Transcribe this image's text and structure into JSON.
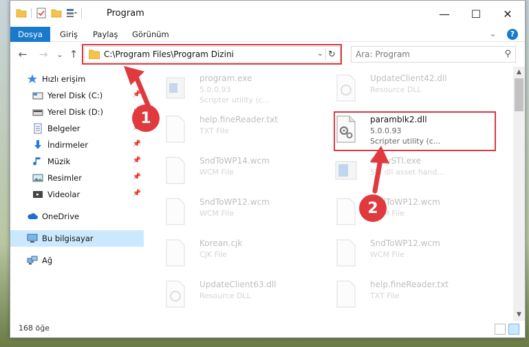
{
  "window": {
    "title": "Program",
    "minimize_glyph": "—",
    "maximize_glyph": "☐",
    "close_glyph": "✕"
  },
  "ribbon": {
    "tabs": [
      "Dosya",
      "Giriş",
      "Paylaş",
      "Görünüm"
    ],
    "expand_glyph": "⌄",
    "help_glyph": "?"
  },
  "nav": {
    "back_glyph": "←",
    "forward_glyph": "→",
    "recent_glyph": "⌄",
    "up_glyph": "↑",
    "address": "C:\\Program Files\\Program Dizini",
    "dropdown_glyph": "⌄",
    "refresh_glyph": "↻",
    "search_placeholder": "Ara: Program",
    "search_glyph": "⚲"
  },
  "sidebar": {
    "items": [
      {
        "label": "Hızlı erişim",
        "icon": "star-icon"
      },
      {
        "label": "Yerel Disk (C:)",
        "icon": "drive-icon",
        "pinned": true
      },
      {
        "label": "Yerel Disk (D:)",
        "icon": "drive-icon",
        "pinned": true
      },
      {
        "label": "Belgeler",
        "icon": "documents-icon",
        "pinned": true
      },
      {
        "label": "İndirmeler",
        "icon": "download-icon",
        "pinned": true
      },
      {
        "label": "Müzik",
        "icon": "music-icon",
        "pinned": true
      },
      {
        "label": "Resimler",
        "icon": "pictures-icon",
        "pinned": true
      },
      {
        "label": "Videolar",
        "icon": "videos-icon",
        "pinned": true
      },
      {
        "label": "OneDrive",
        "icon": "cloud-icon"
      },
      {
        "label": "Bu bilgisayar",
        "icon": "computer-icon",
        "selected": true
      },
      {
        "label": "Ağ",
        "icon": "network-icon"
      }
    ],
    "pin_glyph": "📌"
  },
  "files": [
    {
      "name": "program.exe",
      "line2": "5.0.0.93",
      "line3": "Scripter utility (c...",
      "icon": "exe-icon",
      "faded": true
    },
    {
      "name": "UpdateClient42.dll",
      "line2": "Resource DLL",
      "line3": "",
      "icon": "dll-icon",
      "faded": true
    },
    {
      "name": "help.fineReader.txt",
      "line2": "TXT File",
      "line3": "",
      "icon": "text-file-icon",
      "faded": true
    },
    {
      "name": "paramblk2.dll",
      "line2": "5.0.0.93",
      "line3": "Scripter utility (c...",
      "icon": "dll-gear-icon",
      "faded": false
    },
    {
      "name": "SndToWP14.wcm",
      "line2": "WCM File",
      "line3": "",
      "icon": "blank-file-icon",
      "faded": true
    },
    {
      "name": "CopySTI.exe",
      "line2": "STI dll asset hand...",
      "line3": "",
      "icon": "exe-icon",
      "faded": true
    },
    {
      "name": "SndToWP12.wcm",
      "line2": "WCM File",
      "line3": "",
      "icon": "blank-file-icon",
      "faded": true
    },
    {
      "name": "SndToWP12.wcm",
      "line2": "WCM File",
      "line3": "",
      "icon": "blank-file-icon",
      "faded": true
    },
    {
      "name": "Korean.cjk",
      "line2": "CJK File",
      "line3": "",
      "icon": "blank-file-icon",
      "faded": true
    },
    {
      "name": "SndToWP12.wcm",
      "line2": "WCM File",
      "line3": "",
      "icon": "blank-file-icon",
      "faded": true
    },
    {
      "name": "UpdateClient63.dll",
      "line2": "Resource DLL",
      "line3": "",
      "icon": "dll-icon",
      "faded": true
    },
    {
      "name": "help.fineReader.txt",
      "line2": "TXT File",
      "line3": "",
      "icon": "text-file-icon",
      "faded": true
    }
  ],
  "status": {
    "count": "168 öğe"
  },
  "annotations": {
    "step1": "1",
    "step2": "2",
    "color": "#e0393e"
  },
  "colors": {
    "accent": "#1979ca",
    "selected_bg": "#cce8ff",
    "highlight_red": "#d8383e"
  }
}
